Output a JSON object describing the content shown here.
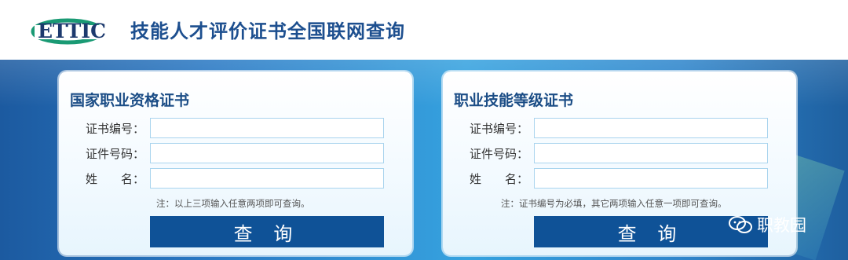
{
  "header": {
    "logo_text": "ETTIC",
    "title": "技能人才评价证书全国联网查询"
  },
  "panels": [
    {
      "title": "国家职业资格证书",
      "fields": [
        {
          "label": "证书编号：",
          "value": ""
        },
        {
          "label": "证件号码：",
          "value": ""
        },
        {
          "label": "姓　　名：",
          "value": ""
        }
      ],
      "note": "注：以上三项输入任意两项即可查询。",
      "button": "查 询"
    },
    {
      "title": "职业技能等级证书",
      "fields": [
        {
          "label": "证书编号：",
          "value": ""
        },
        {
          "label": "证件号码：",
          "value": ""
        },
        {
          "label": "姓　　名：",
          "value": ""
        }
      ],
      "note": "注：证书编号为必填，其它两项输入任意一项即可查询。",
      "button": "查 询"
    }
  ],
  "watermark": {
    "icon": "wechat-icon",
    "text": "职教园"
  },
  "colors": {
    "title": "#1d4f8f",
    "button": "#0f5297",
    "banner": "#2a79c4"
  }
}
